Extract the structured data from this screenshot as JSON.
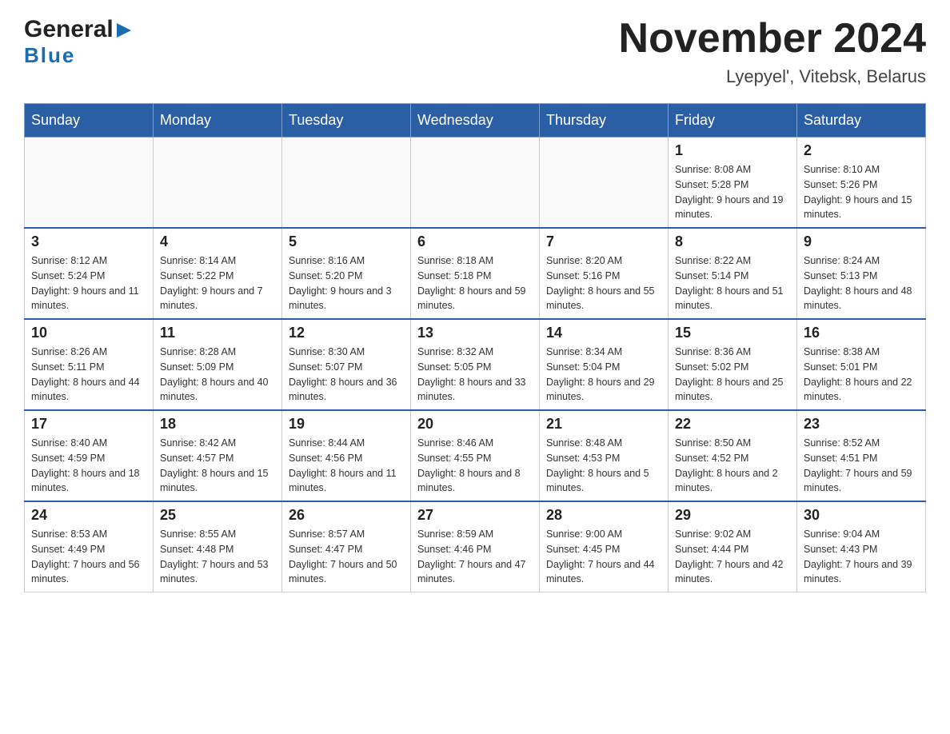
{
  "header": {
    "logo_general": "General",
    "logo_blue": "Blue",
    "title": "November 2024",
    "subtitle": "Lyepyel', Vitebsk, Belarus"
  },
  "weekdays": [
    "Sunday",
    "Monday",
    "Tuesday",
    "Wednesday",
    "Thursday",
    "Friday",
    "Saturday"
  ],
  "weeks": [
    [
      {
        "day": "",
        "sunrise": "",
        "sunset": "",
        "daylight": ""
      },
      {
        "day": "",
        "sunrise": "",
        "sunset": "",
        "daylight": ""
      },
      {
        "day": "",
        "sunrise": "",
        "sunset": "",
        "daylight": ""
      },
      {
        "day": "",
        "sunrise": "",
        "sunset": "",
        "daylight": ""
      },
      {
        "day": "",
        "sunrise": "",
        "sunset": "",
        "daylight": ""
      },
      {
        "day": "1",
        "sunrise": "Sunrise: 8:08 AM",
        "sunset": "Sunset: 5:28 PM",
        "daylight": "Daylight: 9 hours and 19 minutes."
      },
      {
        "day": "2",
        "sunrise": "Sunrise: 8:10 AM",
        "sunset": "Sunset: 5:26 PM",
        "daylight": "Daylight: 9 hours and 15 minutes."
      }
    ],
    [
      {
        "day": "3",
        "sunrise": "Sunrise: 8:12 AM",
        "sunset": "Sunset: 5:24 PM",
        "daylight": "Daylight: 9 hours and 11 minutes."
      },
      {
        "day": "4",
        "sunrise": "Sunrise: 8:14 AM",
        "sunset": "Sunset: 5:22 PM",
        "daylight": "Daylight: 9 hours and 7 minutes."
      },
      {
        "day": "5",
        "sunrise": "Sunrise: 8:16 AM",
        "sunset": "Sunset: 5:20 PM",
        "daylight": "Daylight: 9 hours and 3 minutes."
      },
      {
        "day": "6",
        "sunrise": "Sunrise: 8:18 AM",
        "sunset": "Sunset: 5:18 PM",
        "daylight": "Daylight: 8 hours and 59 minutes."
      },
      {
        "day": "7",
        "sunrise": "Sunrise: 8:20 AM",
        "sunset": "Sunset: 5:16 PM",
        "daylight": "Daylight: 8 hours and 55 minutes."
      },
      {
        "day": "8",
        "sunrise": "Sunrise: 8:22 AM",
        "sunset": "Sunset: 5:14 PM",
        "daylight": "Daylight: 8 hours and 51 minutes."
      },
      {
        "day": "9",
        "sunrise": "Sunrise: 8:24 AM",
        "sunset": "Sunset: 5:13 PM",
        "daylight": "Daylight: 8 hours and 48 minutes."
      }
    ],
    [
      {
        "day": "10",
        "sunrise": "Sunrise: 8:26 AM",
        "sunset": "Sunset: 5:11 PM",
        "daylight": "Daylight: 8 hours and 44 minutes."
      },
      {
        "day": "11",
        "sunrise": "Sunrise: 8:28 AM",
        "sunset": "Sunset: 5:09 PM",
        "daylight": "Daylight: 8 hours and 40 minutes."
      },
      {
        "day": "12",
        "sunrise": "Sunrise: 8:30 AM",
        "sunset": "Sunset: 5:07 PM",
        "daylight": "Daylight: 8 hours and 36 minutes."
      },
      {
        "day": "13",
        "sunrise": "Sunrise: 8:32 AM",
        "sunset": "Sunset: 5:05 PM",
        "daylight": "Daylight: 8 hours and 33 minutes."
      },
      {
        "day": "14",
        "sunrise": "Sunrise: 8:34 AM",
        "sunset": "Sunset: 5:04 PM",
        "daylight": "Daylight: 8 hours and 29 minutes."
      },
      {
        "day": "15",
        "sunrise": "Sunrise: 8:36 AM",
        "sunset": "Sunset: 5:02 PM",
        "daylight": "Daylight: 8 hours and 25 minutes."
      },
      {
        "day": "16",
        "sunrise": "Sunrise: 8:38 AM",
        "sunset": "Sunset: 5:01 PM",
        "daylight": "Daylight: 8 hours and 22 minutes."
      }
    ],
    [
      {
        "day": "17",
        "sunrise": "Sunrise: 8:40 AM",
        "sunset": "Sunset: 4:59 PM",
        "daylight": "Daylight: 8 hours and 18 minutes."
      },
      {
        "day": "18",
        "sunrise": "Sunrise: 8:42 AM",
        "sunset": "Sunset: 4:57 PM",
        "daylight": "Daylight: 8 hours and 15 minutes."
      },
      {
        "day": "19",
        "sunrise": "Sunrise: 8:44 AM",
        "sunset": "Sunset: 4:56 PM",
        "daylight": "Daylight: 8 hours and 11 minutes."
      },
      {
        "day": "20",
        "sunrise": "Sunrise: 8:46 AM",
        "sunset": "Sunset: 4:55 PM",
        "daylight": "Daylight: 8 hours and 8 minutes."
      },
      {
        "day": "21",
        "sunrise": "Sunrise: 8:48 AM",
        "sunset": "Sunset: 4:53 PM",
        "daylight": "Daylight: 8 hours and 5 minutes."
      },
      {
        "day": "22",
        "sunrise": "Sunrise: 8:50 AM",
        "sunset": "Sunset: 4:52 PM",
        "daylight": "Daylight: 8 hours and 2 minutes."
      },
      {
        "day": "23",
        "sunrise": "Sunrise: 8:52 AM",
        "sunset": "Sunset: 4:51 PM",
        "daylight": "Daylight: 7 hours and 59 minutes."
      }
    ],
    [
      {
        "day": "24",
        "sunrise": "Sunrise: 8:53 AM",
        "sunset": "Sunset: 4:49 PM",
        "daylight": "Daylight: 7 hours and 56 minutes."
      },
      {
        "day": "25",
        "sunrise": "Sunrise: 8:55 AM",
        "sunset": "Sunset: 4:48 PM",
        "daylight": "Daylight: 7 hours and 53 minutes."
      },
      {
        "day": "26",
        "sunrise": "Sunrise: 8:57 AM",
        "sunset": "Sunset: 4:47 PM",
        "daylight": "Daylight: 7 hours and 50 minutes."
      },
      {
        "day": "27",
        "sunrise": "Sunrise: 8:59 AM",
        "sunset": "Sunset: 4:46 PM",
        "daylight": "Daylight: 7 hours and 47 minutes."
      },
      {
        "day": "28",
        "sunrise": "Sunrise: 9:00 AM",
        "sunset": "Sunset: 4:45 PM",
        "daylight": "Daylight: 7 hours and 44 minutes."
      },
      {
        "day": "29",
        "sunrise": "Sunrise: 9:02 AM",
        "sunset": "Sunset: 4:44 PM",
        "daylight": "Daylight: 7 hours and 42 minutes."
      },
      {
        "day": "30",
        "sunrise": "Sunrise: 9:04 AM",
        "sunset": "Sunset: 4:43 PM",
        "daylight": "Daylight: 7 hours and 39 minutes."
      }
    ]
  ]
}
